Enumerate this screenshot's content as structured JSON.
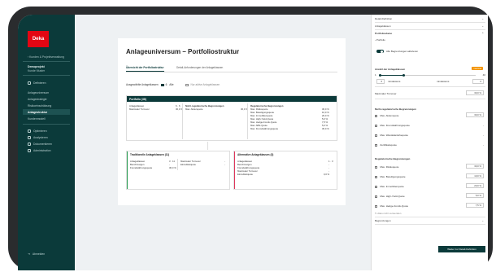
{
  "sidebar": {
    "logo": "Deka",
    "back": "Kunden & Projektverwaltung",
    "project_title": "Demoprojekt",
    "project_sub": "Kunde Muster",
    "section": "Definieren",
    "items": [
      "Anlageuniversum",
      "Anlagestrategie",
      "Risikoeinschätzung",
      "Anlagestruktur",
      "Kundenmodell"
    ],
    "active_index": 3,
    "tools": [
      "Optimieren",
      "Analysieren",
      "Dokumentieren",
      "Administration"
    ],
    "logout": "Abmelden"
  },
  "main": {
    "title": "Anlageuniversum – Portfoliostruktur",
    "tabs": [
      "Übersicht der Portfoliostruktur",
      "Detail-Anforderungen der Anlageklassen"
    ],
    "filter_label": "Ausgewählte Anlageklassen",
    "filter_value": "6",
    "filter_all": "Alle",
    "filter_other": "Nur aktive Anlageklassen",
    "portfolio": {
      "title": "Portfolio (38)",
      "col1": [
        [
          "Anlageklassen",
          "6 · 6"
        ],
        [
          "Maximaler Turnover",
          "30,0 %"
        ]
      ],
      "col2_title": "Nicht-regulatorische Begrenzungen",
      "col2": [
        [
          "Max. Aktienquote",
          "30,0 %"
        ]
      ],
      "col3_title": "Regulatorische Begrenzungen",
      "col3": [
        [
          "Max. Risikoquote",
          "30,0 %"
        ],
        [
          "Max. Beteiligungsquote",
          "10,0 %"
        ],
        [
          "Max. Immobilienquote",
          "20,0 %"
        ],
        [
          "Max. High-Yield-Quote",
          "5,0 %"
        ],
        [
          "Max. Hedge-Fonds-Quote",
          "7,5 %"
        ],
        [
          "Max. ABS-Quote",
          "5,0 %"
        ],
        [
          "Max. Fremdwährungsquote",
          "30,0 %"
        ]
      ]
    },
    "traditional": {
      "title": "Traditionelle Anlageklassen (11)",
      "rows": [
        [
          "Anlageklassen",
          "3 · 11"
        ],
        [
          "Benchmargen",
          "-"
        ],
        [
          "Fremdwährungsquote",
          "30,0 %"
        ]
      ],
      "right": [
        [
          "Maximaler Turnover",
          "-"
        ],
        [
          "Einzeltitelquote",
          "-"
        ]
      ]
    },
    "alternative": {
      "title": "Alternative Anlageklassen (3)",
      "rows": [
        [
          "Anlageklassen",
          "1 · 3"
        ],
        [
          "Benchmargen",
          "-"
        ],
        [
          "Fremdwährungsquote",
          "-"
        ],
        [
          "Maximaler Turnover",
          "-"
        ],
        [
          "Einzeltitelquote",
          "0,0 %"
        ]
      ]
    }
  },
  "right": {
    "accordions": [
      "Detail-Definition",
      "Anlageklassen",
      "Portfolioebene"
    ],
    "sub": "Portfolio",
    "toggle_label": "Alle Begrenzungen aktivieren",
    "count_title": "Anzahl der Anlageklassen",
    "count_badge": "maximal",
    "count_min": "1",
    "count_max": "40",
    "count_fields": [
      "mindestens",
      "6",
      "mindestens",
      "6"
    ],
    "turnover_label": "Maximaler Turnover",
    "turnover_value": "30,0 %",
    "nonreg_title": "Nicht-regulatorische Begrenzungen",
    "nonreg": [
      [
        "Max. Aktienquote",
        "30,0 %"
      ],
      [
        "Max. Fremdwährungsquote",
        "-"
      ],
      [
        "Max. Wandelanleihequote",
        "-"
      ],
      [
        "Zertifikatsquote",
        "-"
      ]
    ],
    "reg_title": "Regulatorische Begrenzungen",
    "reg": [
      [
        "Max. Risikoquote",
        "30,0 %"
      ],
      [
        "Max. Beteiligungsquote",
        "10,0 %"
      ],
      [
        "Max. Immobilienquote",
        "20,0 %"
      ],
      [
        "Max. High-Yield-Quote",
        "5,0 %"
      ],
      [
        "Max. Hedge-Fonds-Quote",
        "7,5 %"
      ]
    ],
    "more": "Alles nicht verwenden",
    "bottom_accordion": "Begrenzungen",
    "button": "Weiter zur Detail-Definition"
  }
}
